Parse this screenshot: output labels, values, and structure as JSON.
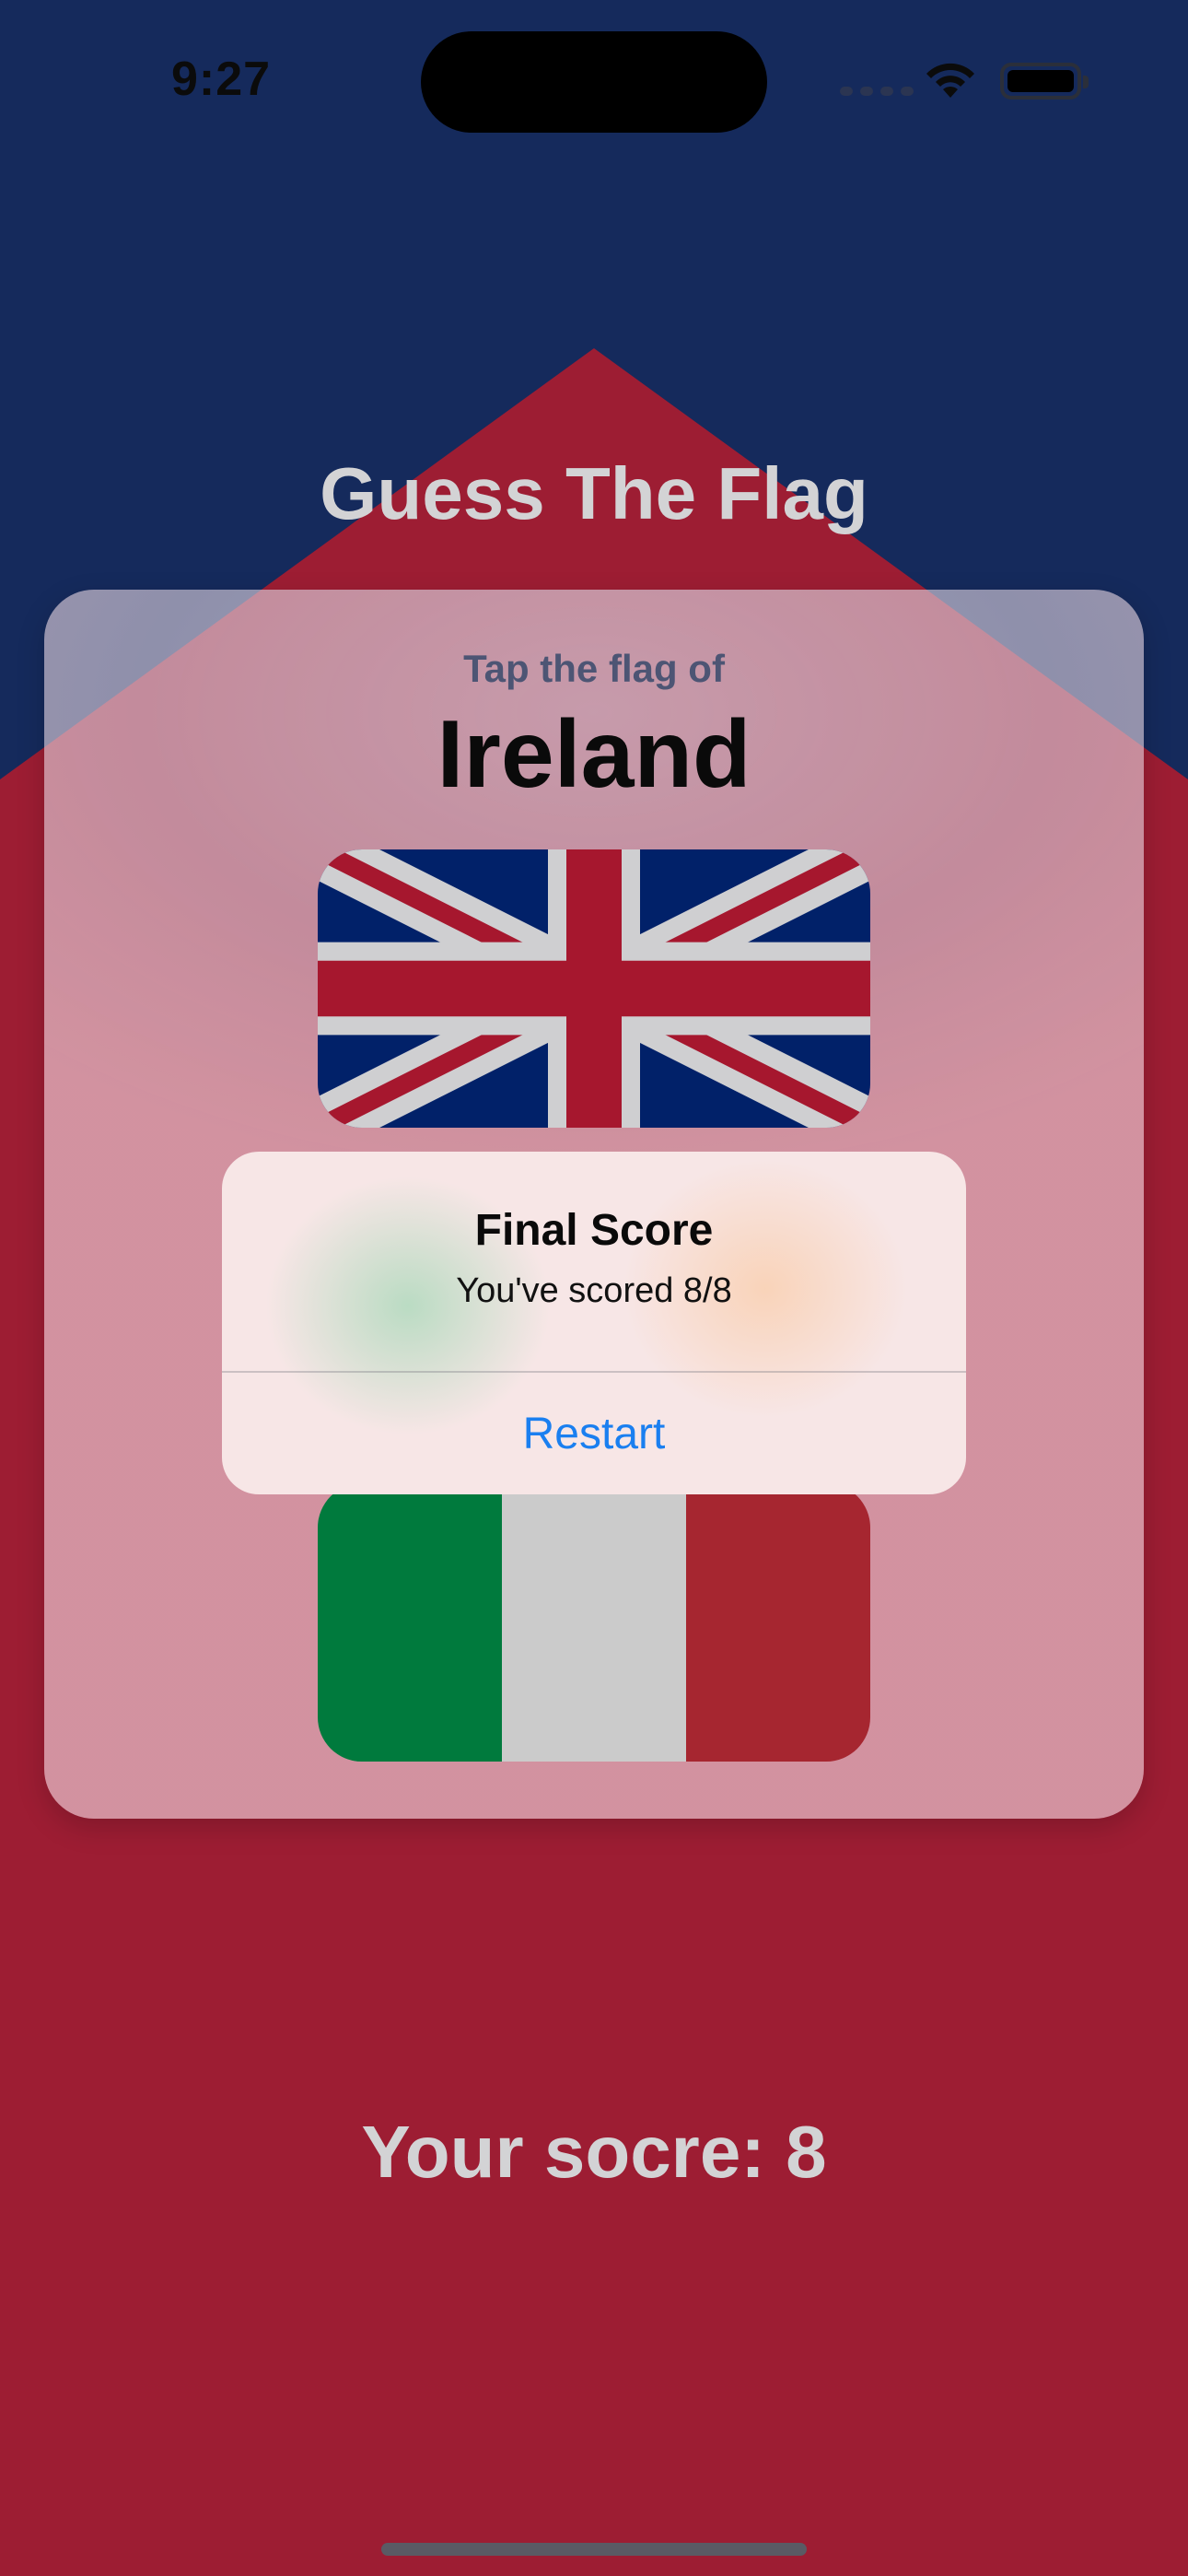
{
  "status_bar": {
    "time": "9:27"
  },
  "app": {
    "title": "Guess The Flag"
  },
  "card": {
    "prompt_label": "Tap the flag of",
    "country": "Ireland"
  },
  "flags": [
    {
      "name": "UK",
      "colors": {
        "blue": "#012169",
        "red": "#A6172E",
        "white": "#CFCFD1"
      }
    },
    {
      "name": "Italy",
      "colors": {
        "green": "#007A3D",
        "white": "#CBCBCB",
        "red": "#A62630"
      }
    }
  ],
  "alert": {
    "title": "Final Score",
    "message": "You've scored 8/8",
    "button": "Restart",
    "button_color": "#1A7FF0"
  },
  "footer": {
    "score_text": "Your socre: 8"
  },
  "colors": {
    "background_top": "#152A5C",
    "background_bottom": "#9D1D33",
    "title_text": "#D3D3D5"
  }
}
